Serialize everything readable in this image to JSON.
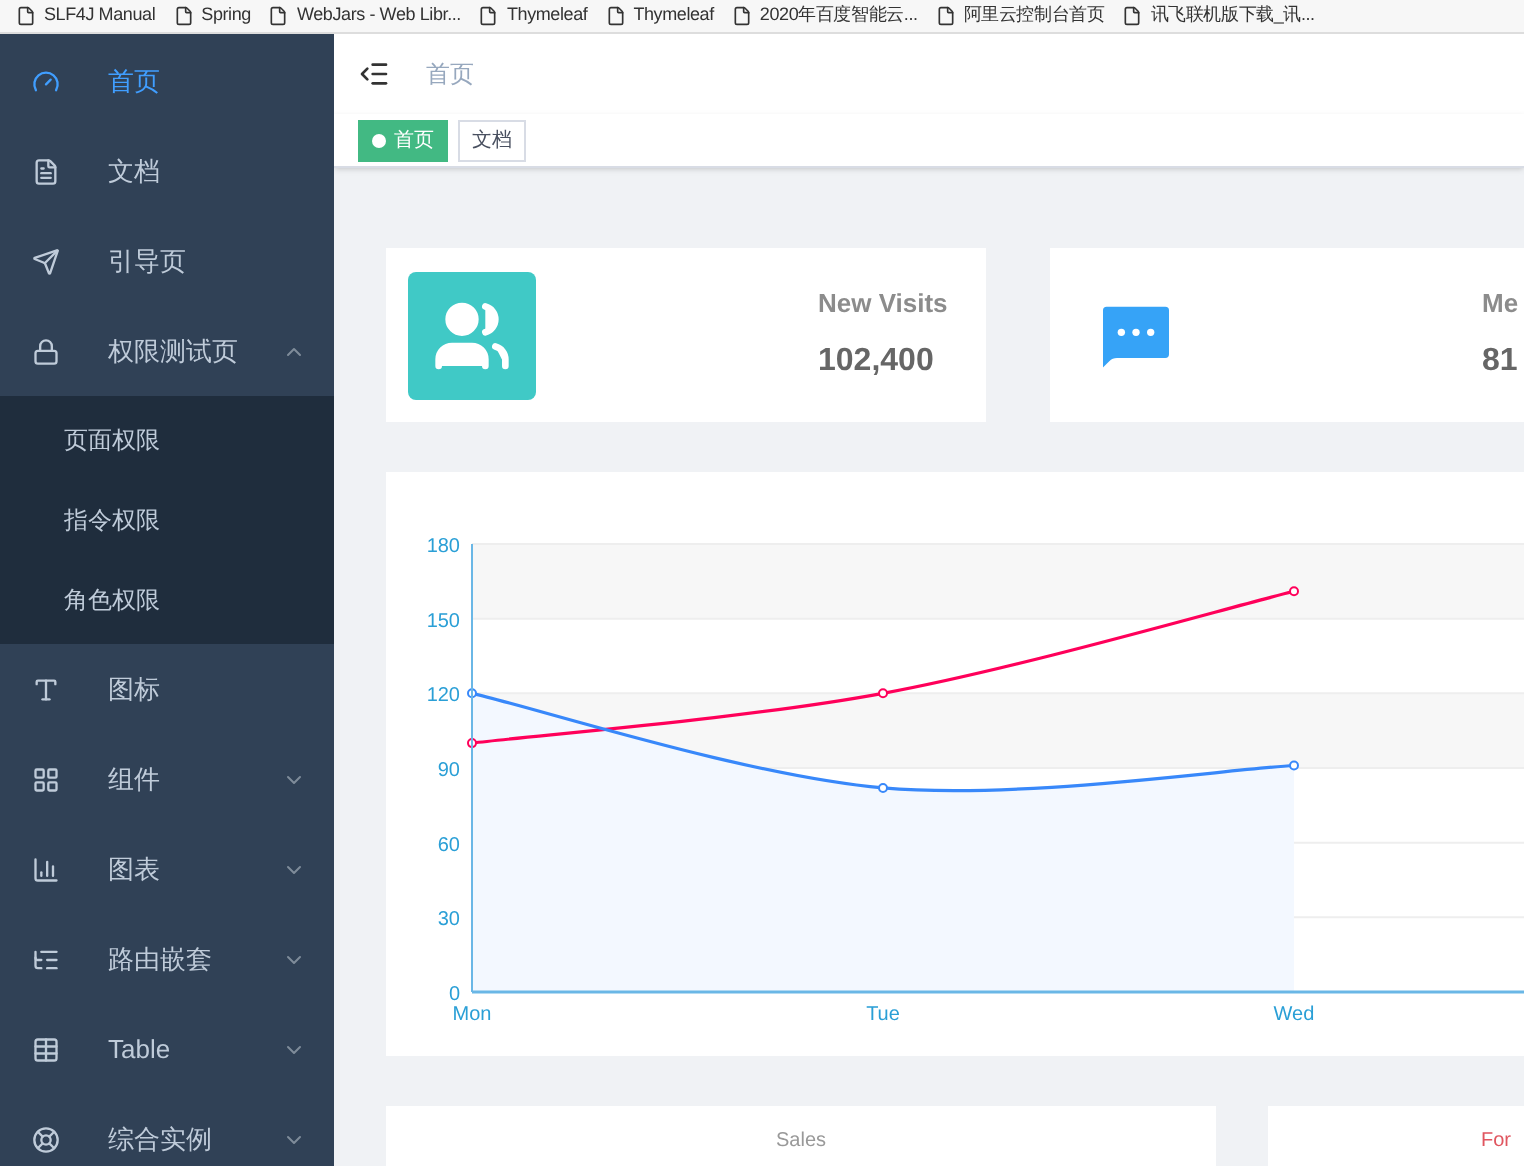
{
  "bookmarks": [
    {
      "label": "SLF4J Manual"
    },
    {
      "label": "Spring"
    },
    {
      "label": "WebJars - Web Libr..."
    },
    {
      "label": "Thymeleaf"
    },
    {
      "label": "Thymeleaf"
    },
    {
      "label": "2020年百度智能云..."
    },
    {
      "label": "阿里云控制台首页"
    },
    {
      "label": "讯飞联机版下载_讯..."
    }
  ],
  "sidebar": {
    "items": [
      {
        "label": "首页",
        "selected": true
      },
      {
        "label": "文档",
        "selected": false
      },
      {
        "label": "引导页",
        "selected": false
      },
      {
        "label": "权限测试页",
        "selected": false,
        "expanded": true,
        "children": [
          {
            "label": "页面权限",
            "selected": false
          },
          {
            "label": "指令权限",
            "selected": false
          },
          {
            "label": "角色权限",
            "selected": false
          }
        ]
      },
      {
        "label": "图标",
        "selected": false
      },
      {
        "label": "组件",
        "selected": false,
        "expanded": false
      },
      {
        "label": "图表",
        "selected": false,
        "expanded": false
      },
      {
        "label": "路由嵌套",
        "selected": false,
        "expanded": false
      },
      {
        "label": "Table",
        "selected": false,
        "expanded": false
      },
      {
        "label": "综合实例",
        "selected": false,
        "expanded": false
      }
    ]
  },
  "breadcrumb": [
    "首页"
  ],
  "tags": [
    {
      "label": "首页",
      "selected": true
    },
    {
      "label": "文档",
      "selected": false
    }
  ],
  "panels": [
    {
      "title": "New Visits",
      "value": "102,400"
    },
    {
      "title": "Me",
      "value": "81"
    }
  ],
  "chart": {
    "chart_data": {
      "type": "line",
      "categories": [
        "Mon",
        "Tue",
        "Wed"
      ],
      "ylim": [
        0,
        180
      ],
      "yticks": [
        0,
        30,
        60,
        90,
        120,
        150,
        180
      ],
      "grid": true,
      "series": [
        {
          "color": "#ff005a",
          "marker": true,
          "values": [
            100,
            120,
            161
          ]
        },
        {
          "color": "#3888fa",
          "marker": true,
          "values": [
            120,
            82,
            91
          ]
        }
      ]
    }
  },
  "bottom_cards": [
    {
      "title": "Sales",
      "color": "#999999"
    },
    {
      "title": "For",
      "color": "#e0555f"
    }
  ]
}
